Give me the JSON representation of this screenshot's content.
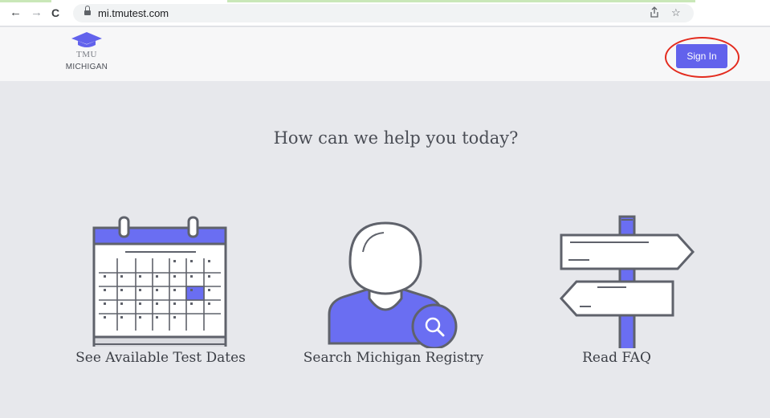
{
  "browser": {
    "url": "mi.tmutest.com",
    "nav": {
      "back": "←",
      "forward": "→",
      "reload": "C"
    },
    "share_icon": "share-icon",
    "bookmark_icon": "star-icon"
  },
  "header": {
    "logo_line1": "TMU",
    "logo_line2": "MICHIGAN",
    "sign_in_label": "Sign In"
  },
  "main": {
    "headline": "How can we help you today?",
    "cards": [
      {
        "label": "See Available Test Dates",
        "icon": "calendar-icon"
      },
      {
        "label": "Search Michigan Registry",
        "icon": "person-search-icon"
      },
      {
        "label": "Read FAQ",
        "icon": "signpost-icon"
      }
    ]
  },
  "colors": {
    "accent": "#6262ec",
    "annotation": "#e32b1e",
    "page_bg": "#e7e8ec",
    "header_bg": "#f7f7f8",
    "outline": "#5f626b"
  }
}
